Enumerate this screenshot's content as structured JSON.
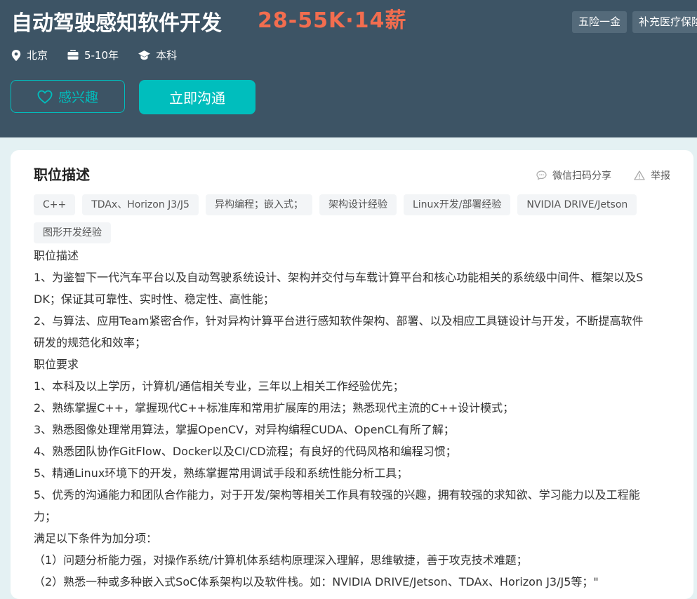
{
  "header": {
    "title": "自动驾驶感知软件开发",
    "salary": "28-55K·14薪",
    "benefits": [
      "五险一金",
      "补充医疗保险"
    ],
    "meta": {
      "location": "北京",
      "experience": "5-10年",
      "education": "本科"
    },
    "interest_label": "感兴趣",
    "chat_label": "立即沟通"
  },
  "section": {
    "title": "职位描述",
    "share_label": "微信扫码分享",
    "report_label": "举报",
    "tags": [
      "C++",
      "TDAx、Horizon J3/J5",
      "异构编程；嵌入式；",
      "架构设计经验",
      "Linux开发/部署经验",
      "NVIDIA DRIVE/Jetson",
      "图形开发经验"
    ],
    "lines": [
      "职位描述",
      "1、为鉴智下一代汽车平台以及自动驾驶系统设计、架构并交付与车载计算平台和核心功能相关的系统级中间件、框架以及S",
      "DK；保证其可靠性、实时性、稳定性、高性能；",
      "2、与算法、应用Team紧密合作，针对异构计算平台进行感知软件架构、部署、以及相应工具链设计与开发，不断提高软件",
      "研发的规范化和效率；",
      "职位要求",
      "1、本科及以上学历，计算机/通信相关专业，三年以上相关工作经验优先；",
      "2、熟练掌握C++，掌握现代C++标准库和常用扩展库的用法；熟悉现代主流的C++设计模式；",
      "3、熟悉图像处理常用算法，掌握OpenCV，对异构编程CUDA、OpenCL有所了解；",
      "4、熟悉团队协作GitFlow、Docker以及CI/CD流程；有良好的代码风格和编程习惯；",
      "5、精通Linux环境下的开发，熟练掌握常用调试手段和系统性能分析工具；",
      "5、优秀的沟通能力和团队合作能力，对于开发/架构等相关工作具有较强的兴趣，拥有较强的求知欲、学习能力以及工程能",
      "力；",
      "满足以下条件为加分项：",
      "（1）问题分析能力强，对操作系统/计算机体系结构原理深入理解，思维敏捷，善于攻克技术难题；",
      "（2）熟悉一种或多种嵌入式SoC体系架构以及软件栈。如：NVIDIA DRIVE/Jetson、TDAx、Horizon J3/J5等；\""
    ]
  }
}
